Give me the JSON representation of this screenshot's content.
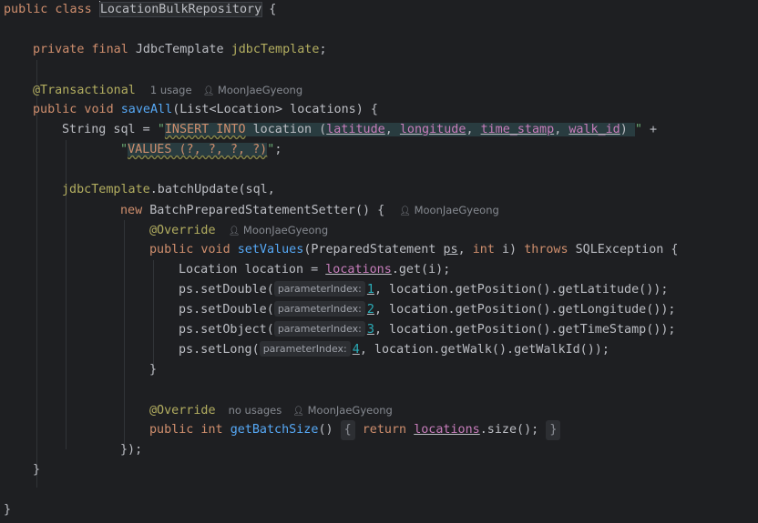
{
  "editor": {
    "lines": {
      "l1": {
        "kw": "public class ",
        "cls": "LocationBulkRepository",
        "rest": " {"
      },
      "l3": {
        "kw": "private final ",
        "type": "JdbcTemplate ",
        "field": "jdbcTemplate",
        "rest": ";"
      },
      "l5": {
        "ann": "@Transactional",
        "usages": "1 usage",
        "author": "MoonJaeGyeong"
      },
      "l6": {
        "kw": "public void ",
        "fn": "saveAll",
        "rest": "(List<Location> locations) {"
      },
      "l7": {
        "prefix": "String sql = ",
        "q1": "\"",
        "sql_insert": "INSERT INTO",
        "sql_table": " location (",
        "c1": "latitude",
        "sep1": ", ",
        "c2": "longitude",
        "sep2": ", ",
        "c3": "time_stamp",
        "sep3": ", ",
        "c4": "walk_id",
        "sql_end": ") ",
        "q2": "\"",
        "plus": " +"
      },
      "l8": {
        "q1": "\"",
        "values": "VALUES (?, ?, ?, ?)",
        "q2": "\"",
        "rest": ";"
      },
      "l10": {
        "obj": "jdbcTemplate",
        "rest": ".batchUpdate(sql,"
      },
      "l11": {
        "kw": "new ",
        "rest": "BatchPreparedStatementSetter() {",
        "author": "MoonJaeGyeong"
      },
      "l12": {
        "ann": "@Override",
        "author": "MoonJaeGyeong"
      },
      "l13": {
        "kw1": "public void ",
        "fn": "setValues",
        "p1": "(PreparedStatement ",
        "ps": "ps",
        "p2": ", ",
        "kw2": "int ",
        "p3": "i) ",
        "kw3": "throws ",
        "p4": "SQLException {"
      },
      "l14": {
        "pre": "Location location = ",
        "field": "locations",
        "rest": ".get(i);"
      },
      "l15": {
        "pre": "ps.setDouble(",
        "hint": "parameterIndex:",
        "num": "1",
        "rest": ", location.getPosition().getLatitude());"
      },
      "l16": {
        "pre": "ps.setDouble(",
        "hint": "parameterIndex:",
        "num": "2",
        "rest": ", location.getPosition().getLongitude());"
      },
      "l17": {
        "pre": "ps.setObject(",
        "hint": "parameterIndex:",
        "num": "3",
        "rest": ", location.getPosition().getTimeStamp());"
      },
      "l18": {
        "pre": "ps.setLong(",
        "hint": "parameterIndex:",
        "num": "4",
        "rest": ", location.getWalk().getWalkId());"
      },
      "l19": {
        "text": "}"
      },
      "l21": {
        "ann": "@Override",
        "usages": "no usages",
        "author": "MoonJaeGyeong"
      },
      "l22": {
        "kw": "public int ",
        "fn": "getBatchSize",
        "p1": "()",
        "fold_open": "{",
        "kw2": "return ",
        "field": "locations",
        "rest": ".size();",
        "fold_close": "}"
      },
      "l23": {
        "text": "});"
      },
      "l24": {
        "text": "}"
      },
      "l26": {
        "text": "}"
      }
    }
  }
}
